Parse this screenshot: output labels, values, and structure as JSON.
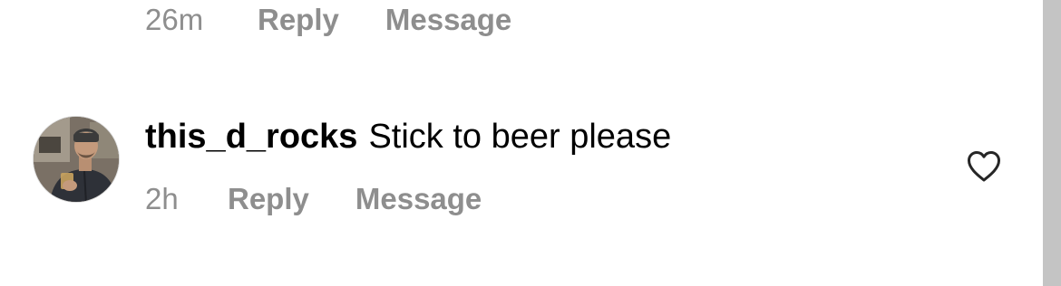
{
  "comments": [
    {
      "time": "26m",
      "reply_label": "Reply",
      "message_label": "Message"
    },
    {
      "username": "this_d_rocks",
      "text": "Stick to beer please",
      "time": "2h",
      "reply_label": "Reply",
      "message_label": "Message",
      "avatar_icon": "user-avatar-photo",
      "like_icon": "heart-outline-icon"
    }
  ],
  "colors": {
    "text_primary": "#000000",
    "text_secondary": "#8e8e8e",
    "scrollbar": "#c4c4c4",
    "background": "#ffffff"
  }
}
